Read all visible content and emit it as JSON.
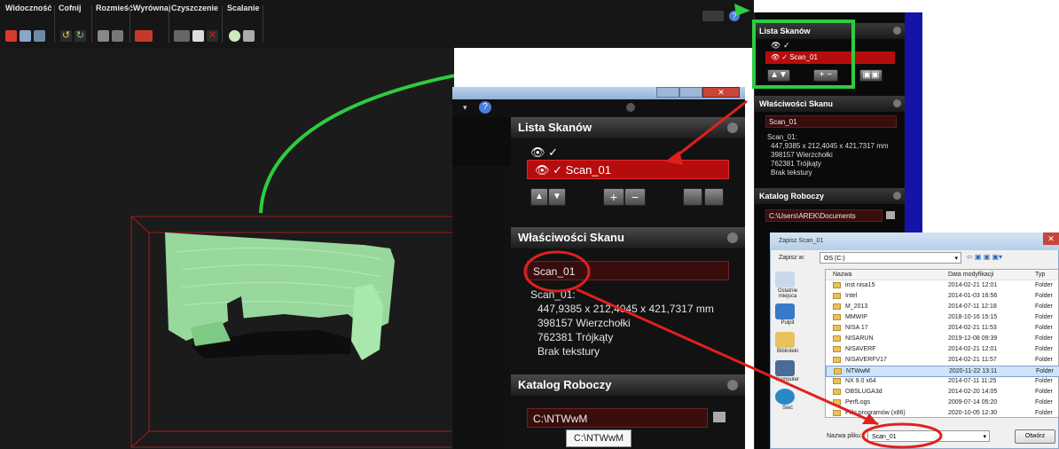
{
  "toolbar": {
    "groups": [
      "Widoczność",
      "Cofnij",
      "Rozmieść",
      "Wyrównaj",
      "Czyszczenie",
      "Scalanie"
    ]
  },
  "narrow_panel": {
    "scan_list_title": "Lista Skanów",
    "scan_item": "Scan_01",
    "properties_title": "Właściwości Skanu",
    "scan_name": "Scan_01",
    "info_name": "Scan_01:",
    "dimensions": "447,9385 x 212,4045 x 421,7317 mm",
    "vertices": "398157 Wierzchołki",
    "triangles": "762381 Trójkąty",
    "texture": "Brak tekstury",
    "workdir_title": "Katalog Roboczy",
    "workdir_path": "C:\\Users\\AREK\\Documents"
  },
  "zoom_panel": {
    "scan_list_title": "Lista Skanów",
    "scan_item": "Scan_01",
    "properties_title": "Właściwości Skanu",
    "scan_name": "Scan_01",
    "info_name": "Scan_01:",
    "dimensions": "447,9385 x 212,4045 x 421,7317 mm",
    "vertices": "398157 Wierzchołki",
    "triangles": "762381 Trójkąty",
    "texture": "Brak tekstury",
    "workdir_title": "Katalog Roboczy",
    "workdir_path": "C:\\NTWwM",
    "tooltip": "C:\\NTWwM"
  },
  "dialog": {
    "title": "Zapisz Scan_01",
    "save_in_label": "Zapisz w:",
    "save_in_value": "OS (C:)",
    "columns": [
      "Nazwa",
      "Data modyfikacji",
      "Typ"
    ],
    "places": [
      "Ostatnie miejsca",
      "Pulpit",
      "Biblioteki",
      "Komputer",
      "Sieć"
    ],
    "rows": [
      {
        "name": "inst nisa15",
        "date": "2014-02-21 12:01",
        "type": "Folder"
      },
      {
        "name": "Intel",
        "date": "2014-01-03 16:56",
        "type": "Folder"
      },
      {
        "name": "M_2013",
        "date": "2014-07-11 12:18",
        "type": "Folder"
      },
      {
        "name": "MMWIP",
        "date": "2018-10-16 15:15",
        "type": "Folder"
      },
      {
        "name": "NISA 17",
        "date": "2014-02-21 11:53",
        "type": "Folder"
      },
      {
        "name": "NISARUN",
        "date": "2019-12-08 09:39",
        "type": "Folder"
      },
      {
        "name": "NISAVERF",
        "date": "2014-02-21 12:01",
        "type": "Folder"
      },
      {
        "name": "NISAVERFV17",
        "date": "2014-02-21 11:57",
        "type": "Folder"
      },
      {
        "name": "NTWwM",
        "date": "2020-11-22 13:11",
        "type": "Folder"
      },
      {
        "name": "NX 9.0 x64",
        "date": "2014-07-11 11:25",
        "type": "Folder"
      },
      {
        "name": "OBSLUGA3d",
        "date": "2014-02-20 14:05",
        "type": "Folder"
      },
      {
        "name": "PerfLogs",
        "date": "2009-07-14 05:20",
        "type": "Folder"
      },
      {
        "name": "Pliki programów (x86)",
        "date": "2020-10-05 12:30",
        "type": "Folder"
      }
    ],
    "filename_label": "Nazwa pliku:",
    "filename_value": "Scan_01",
    "open_button": "Otwórz"
  },
  "colors": {
    "annotation_green": "#2ecc40",
    "annotation_red": "#e0201e",
    "scan_point_cloud": "#9fe3a4",
    "selected_row": "#b50d0d"
  }
}
